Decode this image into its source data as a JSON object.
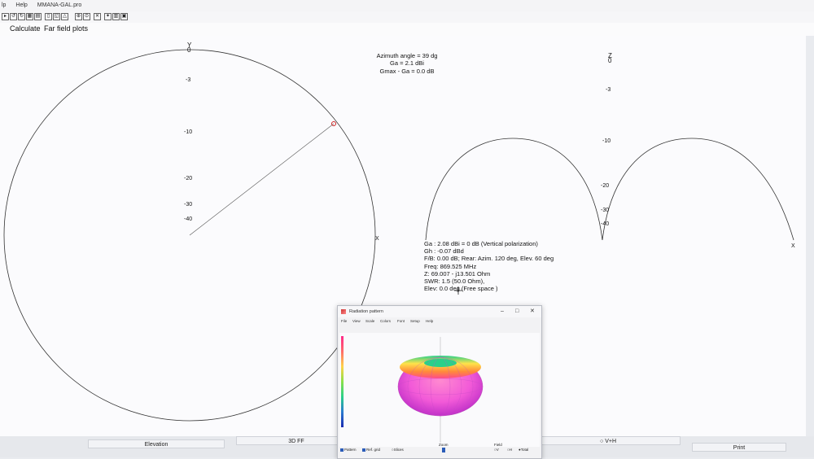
{
  "top_menu": {
    "items": [
      "lp",
      "Help",
      "MMANA-GAL.pro"
    ]
  },
  "menubar": {
    "item_0": "Calculate",
    "item_1": "Far field plots"
  },
  "center_info": {
    "azimuth": "Azimuth angle = 39 dg",
    "ga": "Ga = 2.1 dBi",
    "gmax": "Gmax - Ga = 0.0 dB"
  },
  "left_plot": {
    "axis_y": "Y",
    "axis_x": "X",
    "ticks": [
      "0",
      "-3",
      "-10",
      "-20",
      "-30",
      "-40"
    ]
  },
  "right_plot": {
    "axis_z": "Z",
    "axis_x": "X",
    "ticks": [
      "0",
      "-3",
      "-10",
      "-20",
      "-30",
      "-40"
    ]
  },
  "result_info": {
    "line_ga": "Ga : 2.08 dBi = 0 dB  (Vertical polarization)",
    "line_gh": "Gh : -0.07 dBd",
    "line_fb": "F/B: 0.00 dB; Rear: Azim. 120 deg,  Elev. 60 deg",
    "line_freq": "Freq: 869.525 MHz",
    "line_z": "Z: 69.007 - j13.501 Ohm",
    "line_swr": "SWR: 1.5 (50.0 Ohm),",
    "line_elev": "Elev: 0.0 deg (Free space )"
  },
  "popup": {
    "title": "Radiation pattern",
    "menu": [
      "File",
      "View",
      "Scale",
      "Colors",
      "Font",
      "Setup",
      "Help"
    ],
    "footer": {
      "pattern": "Pattern",
      "ref_grid": "Ref. grid",
      "slices": "Slices",
      "zoom": "Zoom",
      "field": "Field",
      "v": "V",
      "h": "H",
      "total": "Total"
    }
  },
  "bottom_buttons": {
    "elevation": "Elevation",
    "ff3d": "3D FF",
    "vh": "V+H",
    "print": "Print"
  },
  "colors": {
    "pattern_line": "#333333",
    "marker": "#cc2222"
  }
}
